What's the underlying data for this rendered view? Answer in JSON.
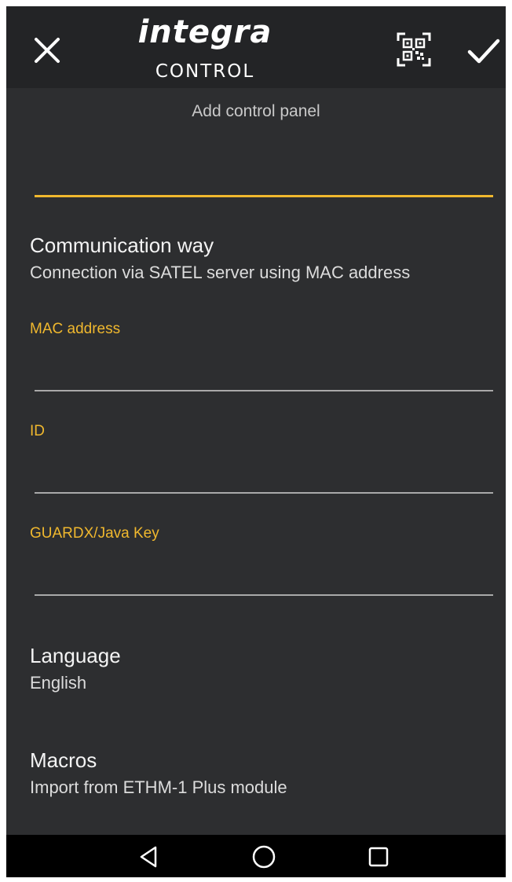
{
  "header": {
    "logo_text": "integra",
    "logo_subtext": "CONTROL",
    "close_icon": "close-icon",
    "qr_icon": "qr-code-icon",
    "confirm_icon": "check-icon"
  },
  "page": {
    "subtitle": "Add control panel",
    "name_value": ""
  },
  "communication": {
    "title": "Communication way",
    "summary": "Connection via SATEL server using MAC address"
  },
  "fields": {
    "mac": {
      "label": "MAC address",
      "value": ""
    },
    "id": {
      "label": "ID",
      "value": ""
    },
    "key": {
      "label": "GUARDX/Java Key",
      "value": ""
    }
  },
  "language": {
    "title": "Language",
    "summary": "English"
  },
  "macros": {
    "title": "Macros",
    "summary": "Import from ETHM-1 Plus module"
  },
  "colors": {
    "accent": "#f0b82e",
    "background": "#2d2e30",
    "toolbar": "#232426",
    "navbar": "#000000"
  },
  "navbar": {
    "back_icon": "back-triangle-icon",
    "home_icon": "home-circle-icon",
    "recents_icon": "recents-square-icon"
  }
}
